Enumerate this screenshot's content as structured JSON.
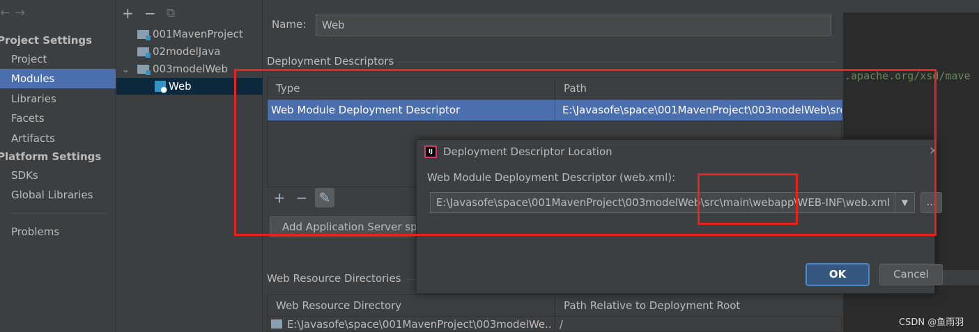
{
  "nav": {
    "back": "←",
    "forward": "→"
  },
  "sidebar": {
    "project_settings_header": "Project Settings",
    "project_items": [
      "Project",
      "Modules",
      "Libraries",
      "Facets",
      "Artifacts"
    ],
    "selected": "Modules",
    "platform_settings_header": "Platform Settings",
    "platform_items": [
      "SDKs",
      "Global Libraries"
    ],
    "problems": "Problems"
  },
  "tree": {
    "toolbar": {
      "add": "+",
      "remove": "−",
      "copy": "⧉"
    },
    "items": [
      "001MavenProject",
      "02modelJava",
      "003modelWeb",
      "Web"
    ],
    "expanded_marker": "⌄",
    "selected": "Web"
  },
  "content": {
    "name_label": "Name:",
    "name_value": "Web",
    "deployment_descriptors_title": "Deployment Descriptors",
    "descriptor_table": {
      "headers": [
        "Type",
        "Path"
      ],
      "rows": [
        {
          "type": "Web Module Deployment Descriptor",
          "path": "E:\\Javasofe\\space\\001MavenProject\\003modelWeb\\src"
        }
      ]
    },
    "toolbar": {
      "add": "+",
      "remove": "−",
      "edit": "✎"
    },
    "add_app_server_button": "Add Application Server sp",
    "web_resource_title": "Web Resource Directories",
    "web_resource_table": {
      "headers": [
        "Web Resource Directory",
        "Path Relative to Deployment Root"
      ],
      "rows": [
        {
          "dir": "E:\\Javasofe\\space\\001MavenProject\\003modelWe...",
          "path": "/"
        }
      ]
    }
  },
  "editor": {
    "code_fragment": ".apache.org/xsd/mave"
  },
  "dialog": {
    "logo": "IJ",
    "title": "Deployment Descriptor Location",
    "close": "✕",
    "field_label": "Web Module Deployment Descriptor (web.xml):",
    "path_value": "E:\\Javasofe\\space\\001MavenProject\\003modelWeb\\src\\main\\webapp\\WEB-INF\\web.xml",
    "dropdown_arrow": "▼",
    "browse": "...",
    "ok": "OK",
    "cancel": "Cancel"
  },
  "watermark": "CSDN @鱼雨羽",
  "colors": {
    "background": "#3c3f41",
    "selection": "#4b6eaf",
    "tree_selection": "#0d293e",
    "annotation_red": "#e8231f",
    "ok_button": "#365880"
  }
}
